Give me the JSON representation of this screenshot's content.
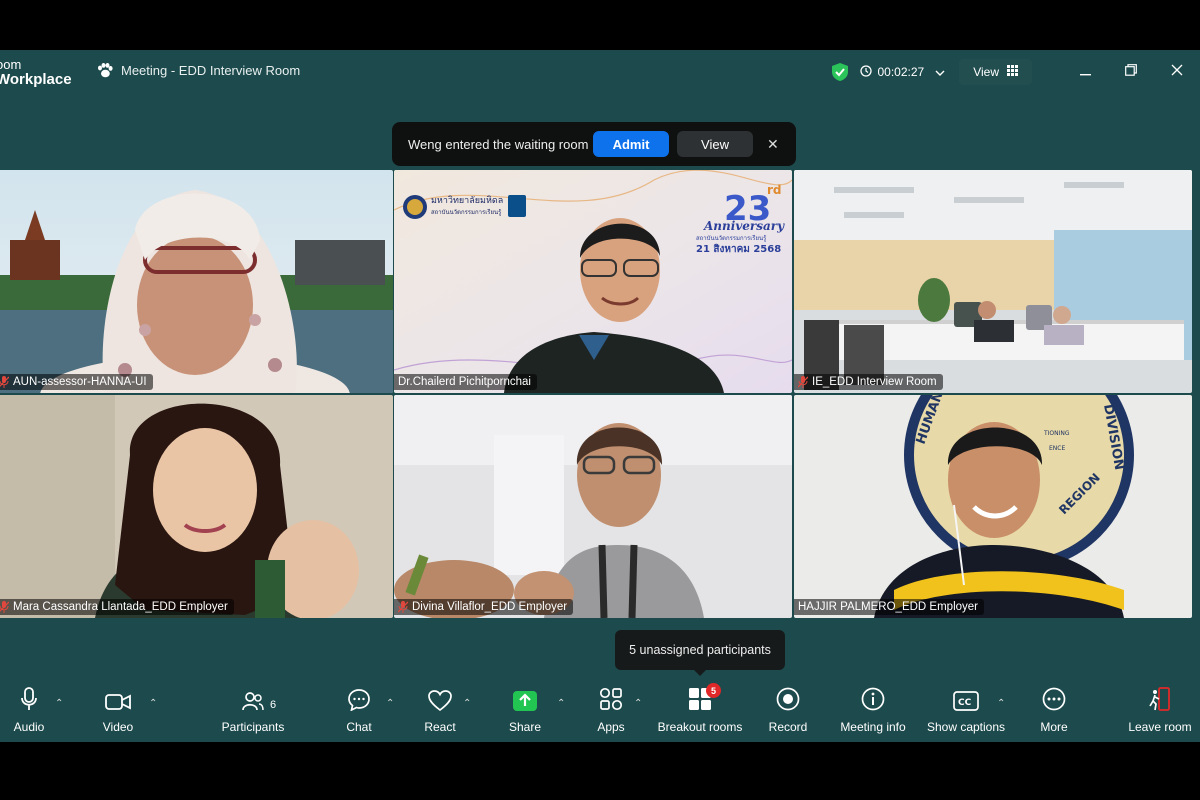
{
  "app": {
    "brand_line1": "oom",
    "brand_line2": "Workplace"
  },
  "titlebar": {
    "meeting_title": "Meeting - EDD Interview Room",
    "timer": "00:02:27",
    "view_label": "View"
  },
  "notification": {
    "text": "Weng entered the waiting room",
    "admit_label": "Admit",
    "view_label": "View"
  },
  "participants": [
    {
      "name": "AUN-assessor-HANNA-UI",
      "muted": true
    },
    {
      "name": "Dr.Chailerd Pichitpornchai",
      "muted": false,
      "active_speaker": true
    },
    {
      "name": "IE_EDD Interview Room",
      "muted": true
    },
    {
      "name": "Mara Cassandra Llantada_EDD Employer",
      "muted": true
    },
    {
      "name": "Divina Villaflor_EDD Employer",
      "muted": true
    },
    {
      "name": "HAJJIR PALMERO_EDD Employer",
      "muted": false
    }
  ],
  "tile2_background": {
    "logo_text_1": "มหาวิทยาลัยมหิดล",
    "logo_text_2": "สถาบันนวัตกรรมการเรียนรู้",
    "anniv_number": "23",
    "anniv_suffix": "rd",
    "anniv_word": "Anniversary",
    "anniv_sub": "สถาบันนวัตกรรมการเรียนรู้",
    "anniv_date": "21 สิงหาคม 2568"
  },
  "tile6_background": {
    "seal_letters_1": "HUMAN R",
    "seal_letters_2": "DIVISION",
    "seal_letters_3": "REGION",
    "seal_letters_4": "TIONING",
    "seal_letters_5": "ENCE"
  },
  "tooltip": {
    "text": "5 unassigned participants"
  },
  "toolbar": {
    "audio": "Audio",
    "video": "Video",
    "participants": "Participants",
    "participants_count": "6",
    "chat": "Chat",
    "react": "React",
    "share": "Share",
    "apps": "Apps",
    "breakout": "Breakout rooms",
    "breakout_badge": "5",
    "record": "Record",
    "meeting_info": "Meeting info",
    "captions": "Show captions",
    "more": "More",
    "leave": "Leave room"
  },
  "colors": {
    "window_bg": "#1d4a4c",
    "admit": "#0e72ed",
    "active_border": "#46d38a",
    "share_green": "#23c552",
    "badge_red": "#e02828"
  }
}
